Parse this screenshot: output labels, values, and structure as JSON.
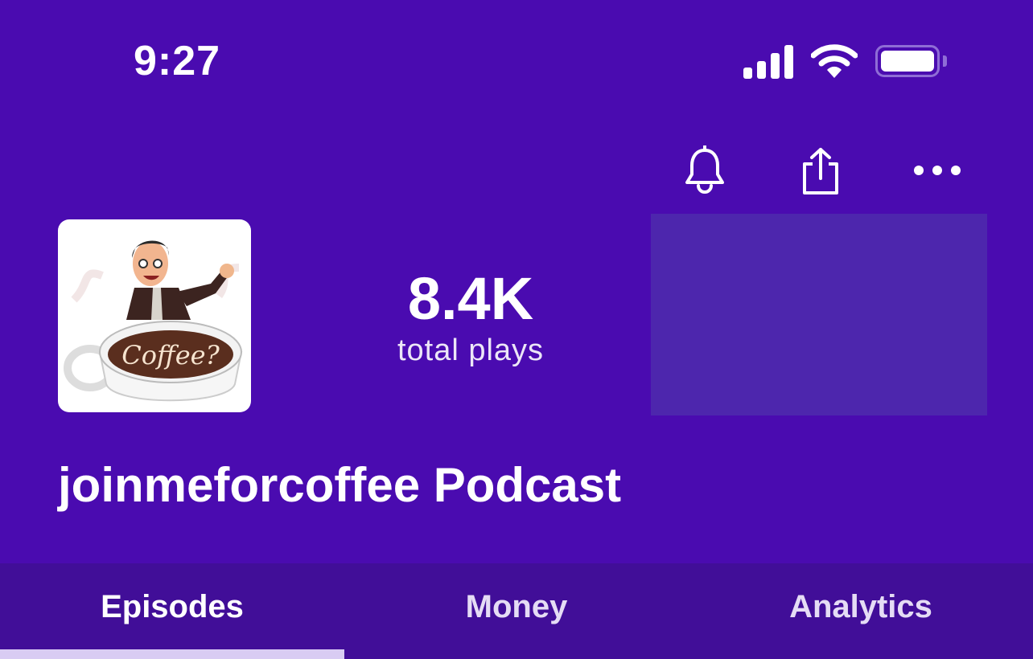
{
  "status_bar": {
    "time": "9:27",
    "icons": [
      "cellular-signal-icon",
      "wifi-icon",
      "battery-icon"
    ]
  },
  "header_actions": {
    "icons": [
      "bell-icon",
      "share-icon",
      "more-icon"
    ]
  },
  "podcast": {
    "title": "joinmeforcoffee Podcast",
    "cover_text": "Coffee?",
    "stats": {
      "value": "8.4K",
      "label": "total plays"
    }
  },
  "tabs": [
    {
      "label": "Episodes",
      "active": true
    },
    {
      "label": "Money",
      "active": false
    },
    {
      "label": "Analytics",
      "active": false
    }
  ],
  "colors": {
    "background": "#4a0bb0",
    "tab_bar": "#410e98",
    "ad_panel": "#4d26ad",
    "indicator": "#d9ccf3"
  }
}
